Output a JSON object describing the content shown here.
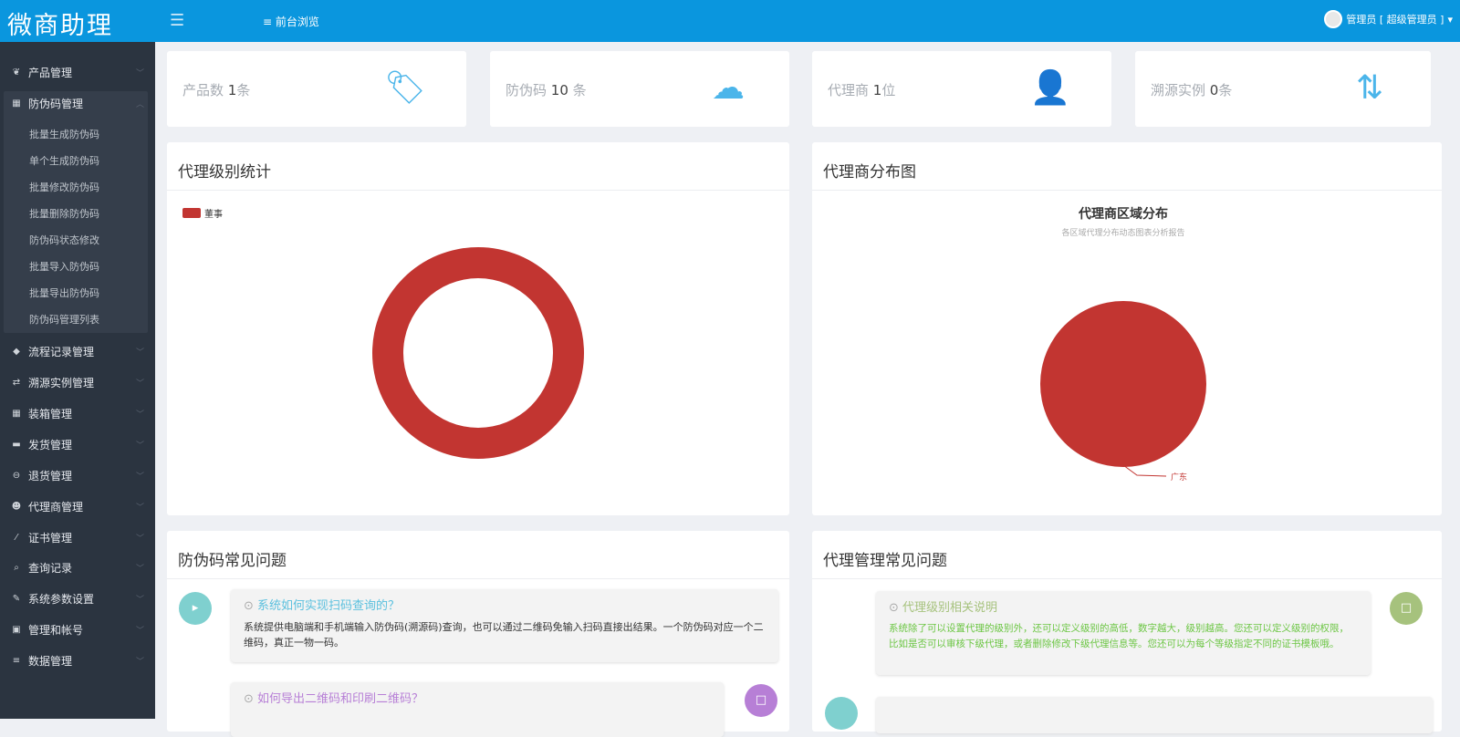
{
  "header": {
    "logo": "微商助理",
    "menu_icon": "hamburger-icon",
    "front_label": "前台浏览",
    "user_label": "管理员 [ 超级管理员 ]"
  },
  "sidebar": {
    "items": [
      {
        "label": "产品管理",
        "icon": "leaf-icon"
      },
      {
        "label": "防伪码管理",
        "icon": "barcode-icon",
        "open": true,
        "children": [
          "批量生成防伪码",
          "单个生成防伪码",
          "批量修改防伪码",
          "批量删除防伪码",
          "防伪码状态修改",
          "批量导入防伪码",
          "批量导出防伪码",
          "防伪码管理列表"
        ]
      },
      {
        "label": "流程记录管理",
        "icon": "tags-icon"
      },
      {
        "label": "溯源实例管理",
        "icon": "retweet-icon"
      },
      {
        "label": "装箱管理",
        "icon": "grid-icon"
      },
      {
        "label": "发货管理",
        "icon": "truck-icon"
      },
      {
        "label": "退货管理",
        "icon": "minus-circle-icon"
      },
      {
        "label": "代理商管理",
        "icon": "users-icon"
      },
      {
        "label": "证书管理",
        "icon": "wand-icon"
      },
      {
        "label": "查询记录",
        "icon": "search-icon"
      },
      {
        "label": "系统参数设置",
        "icon": "wrench-icon"
      },
      {
        "label": "管理和帐号",
        "icon": "lock-icon"
      },
      {
        "label": "数据管理",
        "icon": "list-icon"
      }
    ]
  },
  "stats": [
    {
      "prefix": "产品数 ",
      "value": "1",
      "suffix": "条",
      "icon": "tags-icon"
    },
    {
      "prefix": "防伪码 ",
      "value": "10",
      "suffix": " 条",
      "icon": "cloud-icon"
    },
    {
      "prefix": "代理商 ",
      "value": "1",
      "suffix": "位",
      "icon": "user-icon"
    },
    {
      "prefix": "溯源实例 ",
      "value": "0",
      "suffix": "条",
      "icon": "retweet-icon"
    }
  ],
  "panels": {
    "level": "代理级别统计",
    "dist": "代理商分布图",
    "faq1": "防伪码常见问题",
    "faq2": "代理管理常见问题"
  },
  "chart_data": [
    {
      "type": "pie",
      "variant": "donut",
      "legend": [
        "董事"
      ],
      "categories": [
        "董事"
      ],
      "values": [
        1
      ],
      "colors": [
        "#c23531"
      ],
      "legend_position": "top-left"
    },
    {
      "type": "pie",
      "title": "代理商区域分布",
      "subtitle": "各区域代理分布动态图表分析报告",
      "categories": [
        "广东"
      ],
      "values": [
        1
      ],
      "colors": [
        "#c23531"
      ]
    }
  ],
  "faq1": [
    {
      "q": "系统如何实现扫码查询的？",
      "a": "系统提供电脑端和手机端输入防伪码(溯源码)查询，也可以通过二维码免输入扫码直接出结果。一个防伪码对应一个二维码，真正一物一码。",
      "color": "#7fd0cf"
    },
    {
      "q": "如何导出二维码和印刷二维码？",
      "color": "#b77fd6"
    }
  ],
  "faq2": [
    {
      "q": "代理级别相关说明",
      "a": "系统除了可以设置代理的级别外，还可以定义级别的高低，数字越大，级别越高。您还可以定义级别的权限，比如是否可以审核下级代理，或者删除修改下级代理信息等。您还可以为每个等级指定不同的证书模板哦。",
      "color": "#a6c27d"
    }
  ]
}
